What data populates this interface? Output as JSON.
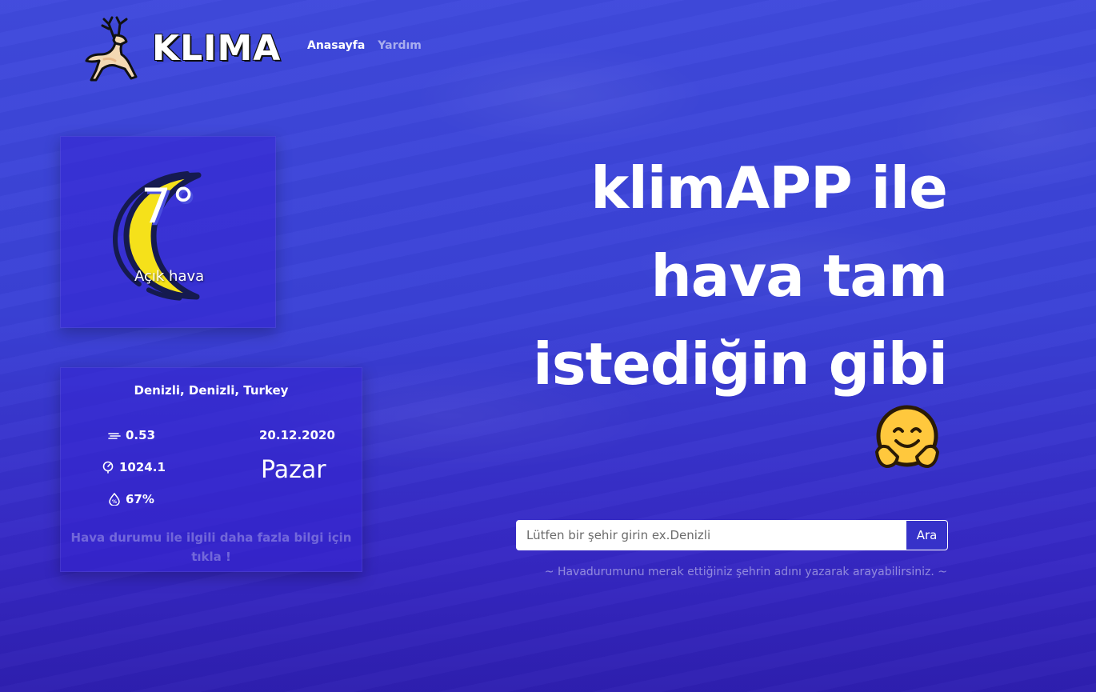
{
  "brand": {
    "name": "KLIMA",
    "logo_icon": "deer-icon"
  },
  "nav": {
    "items": [
      {
        "label": "Anasayfa",
        "active": true
      },
      {
        "label": "Yardım",
        "active": false
      }
    ]
  },
  "weather": {
    "icon": "moon-icon",
    "temperature": "7°",
    "description": "Açık hava",
    "location": "Denizli, Denizli, Turkey",
    "wind": "0.53",
    "pressure": "1024.1",
    "humidity": "67%",
    "date": "20.12.2020",
    "day": "Pazar",
    "more_info": "Hava durumu ile ilgili daha fazla bilgi için tıkla !"
  },
  "hero": {
    "line1": "klimAPP ile",
    "line2": "hava tam",
    "line3": "istediğin gibi",
    "emoji": "hugging-face-icon"
  },
  "search": {
    "placeholder": "Lütfen bir şehir girin ex.Denizli",
    "value": "",
    "button_label": "Ara",
    "hint": "~ Havadurumunu merak ettiğiniz şehrin adını yazarak arayabilirsiniz. ~"
  },
  "colors": {
    "background": "#3f49dc",
    "moon": "#f5e11a",
    "moon_outline": "#151a4f",
    "button": "#3632c9"
  }
}
